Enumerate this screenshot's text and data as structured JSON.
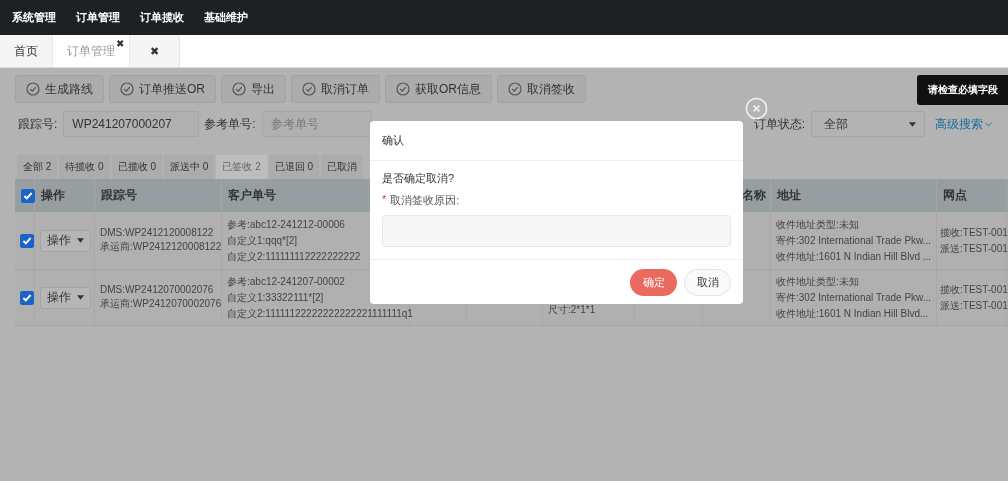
{
  "top_nav": [
    {
      "label": "系统管理"
    },
    {
      "label": "订单管理"
    },
    {
      "label": "订单揽收"
    },
    {
      "label": "基础维护"
    }
  ],
  "page_tabs": [
    {
      "label": "首页",
      "selected": false
    },
    {
      "label": "订单管理",
      "selected": true,
      "close": "✖"
    },
    {
      "close": "✖"
    }
  ],
  "toolbar_buttons": [
    "生成路线",
    "订单推送OR",
    "导出",
    "取消订单",
    "获取OR信息",
    "取消签收"
  ],
  "filters": [
    {
      "kind": "input",
      "label": "跟踪号:",
      "value": "WP241207000207"
    },
    {
      "kind": "input",
      "label": "参考单号:",
      "placeholder": "参考单号"
    },
    {
      "kind": "select",
      "label": "订单状态:",
      "value": "全部"
    }
  ],
  "advanced_search": "高级搜索",
  "tooltip": "请检查必填字段",
  "status_tabs": [
    {
      "label": "全部 2",
      "selected": false
    },
    {
      "label": "待揽收 0",
      "selected": false
    },
    {
      "label": "已揽收 0",
      "selected": false
    },
    {
      "label": "派送中 0",
      "selected": false
    },
    {
      "label": "已签收 2",
      "selected": true
    },
    {
      "label": "已退回 0",
      "selected": false
    },
    {
      "label": "已取消",
      "selected": false
    }
  ],
  "table": {
    "select_all_checked": true,
    "headers": {
      "operation": "操作",
      "tracking": "跟踪号",
      "customer_ref": "客户单号",
      "name": "名称",
      "address": "地址",
      "outlet": "网点"
    },
    "rows": [
      {
        "checked": true,
        "action": "操作",
        "tracking": [
          "DMS:WP2412120008122",
          "承运商:WP2412120008122"
        ],
        "customer_ref": [
          "参考:abc12-241212-00006",
          "自定义1:qqq*[2]",
          "自定义2:111111112222222222"
        ],
        "address": [
          "收件地址类型:未知",
          "寄件:302 International Trade Pkw...",
          "收件地址:1601 N Indian Hill Blvd ..."
        ],
        "outlet": [
          "揽收:TEST-001",
          "派送:TEST-001"
        ]
      },
      {
        "checked": true,
        "action": "操作",
        "tracking": [
          "DMS:WP2412070002076",
          "承运商:WP2412070002076"
        ],
        "customer_ref": [
          "参考:abc12-241207-00002",
          "自定义1:33322111*[2]",
          "自定义2:11111122222222222221111111q1"
        ],
        "size": "尺寸:2*1*1",
        "address": [
          "收件地址类型:未知",
          "寄件:302 International Trade Pkw...",
          "收件地址:1601 N Indian Hill Blvd..."
        ],
        "outlet": [
          "揽收:TEST-001",
          "派送:TEST-001"
        ]
      }
    ]
  },
  "dialog": {
    "title": "确认",
    "message": "是否确定取消?",
    "required_mark": "*",
    "field_label": "取消签收原因:",
    "confirm": "确定",
    "cancel": "取消"
  }
}
